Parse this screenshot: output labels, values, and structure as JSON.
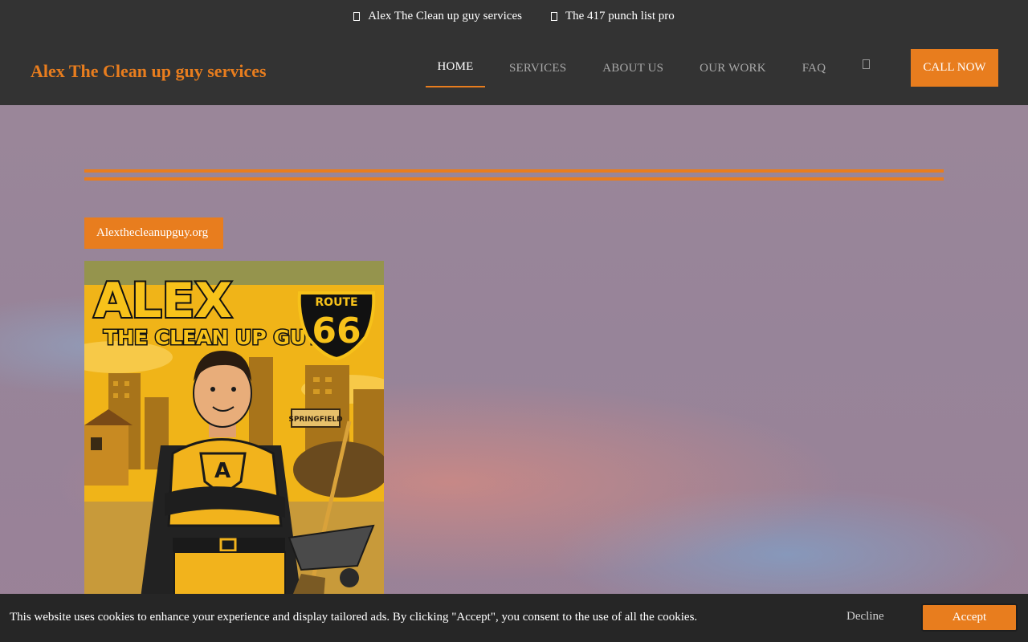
{
  "topbar": {
    "items": [
      {
        "label": "Alex The Clean up guy services",
        "icon": "info-icon"
      },
      {
        "label": "The 417 punch list pro",
        "icon": "info-icon"
      }
    ]
  },
  "header": {
    "brand": "Alex The Clean up guy services",
    "nav": [
      "HOME",
      "SERVICES",
      "ABOUT US",
      "OUR WORK",
      "FAQ"
    ],
    "active_nav": "HOME",
    "search_icon": "search-icon",
    "call_label": "CALL NOW"
  },
  "hero": {
    "tag_label": "Alexthecleanupguy.org",
    "poster": {
      "title_line1": "ALEX",
      "title_line2": "THE CLEAN UP GUY",
      "shield_top": "ROUTE",
      "shield_number": "66",
      "sign": "SPRINGFIELD",
      "emblem": "A"
    }
  },
  "cookie": {
    "message": "This website uses cookies to enhance your experience and display tailored ads. By clicking \"Accept\", you consent to the use of all the cookies.",
    "decline_label": "Decline",
    "accept_label": "Accept"
  },
  "colors": {
    "accent": "#e87d1e",
    "dark": "#333333",
    "cookie_bg": "#262626"
  }
}
